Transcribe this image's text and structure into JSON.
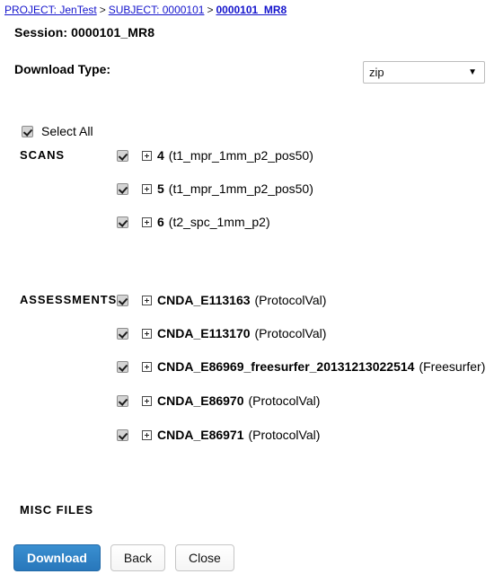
{
  "breadcrumb": {
    "separator": ">",
    "items": [
      {
        "label": "PROJECT: JenTest",
        "current": false
      },
      {
        "label": "SUBJECT: 0000101",
        "current": false
      },
      {
        "label": "0000101_MR8",
        "current": true
      }
    ]
  },
  "session": {
    "title": "Session: 0000101_MR8"
  },
  "download_type": {
    "label": "Download Type:",
    "value": "zip",
    "options": [
      "zip"
    ],
    "arrow": "chevron-down-icon"
  },
  "select_all": {
    "label": "Select All",
    "checked": true
  },
  "sections": {
    "scans": {
      "label": "SCANS",
      "items": [
        {
          "name": "4",
          "desc": "(t1_mpr_1mm_p2_pos50)",
          "checked": true
        },
        {
          "name": "5",
          "desc": "(t1_mpr_1mm_p2_pos50)",
          "checked": true
        },
        {
          "name": "6",
          "desc": "(t2_spc_1mm_p2)",
          "checked": true
        }
      ]
    },
    "assessments": {
      "label": "ASSESSMENTS",
      "items": [
        {
          "name": "CNDA_E113163",
          "desc": "(ProtocolVal)",
          "checked": true
        },
        {
          "name": "CNDA_E113170",
          "desc": "(ProtocolVal)",
          "checked": true
        },
        {
          "name": "CNDA_E86969_freesurfer_20131213022514",
          "desc": "(Freesurfer)",
          "checked": true
        },
        {
          "name": "CNDA_E86970",
          "desc": "(ProtocolVal)",
          "checked": true
        },
        {
          "name": "CNDA_E86971",
          "desc": "(ProtocolVal)",
          "checked": true
        }
      ]
    },
    "misc_files": {
      "label": "MISC FILES",
      "items": []
    }
  },
  "buttons": {
    "download": "Download",
    "back": "Back",
    "close": "Close"
  },
  "colors": {
    "link": "#1414cc",
    "primary_button": "#2877bb",
    "checkbox_fill": "#d4d4d4"
  }
}
